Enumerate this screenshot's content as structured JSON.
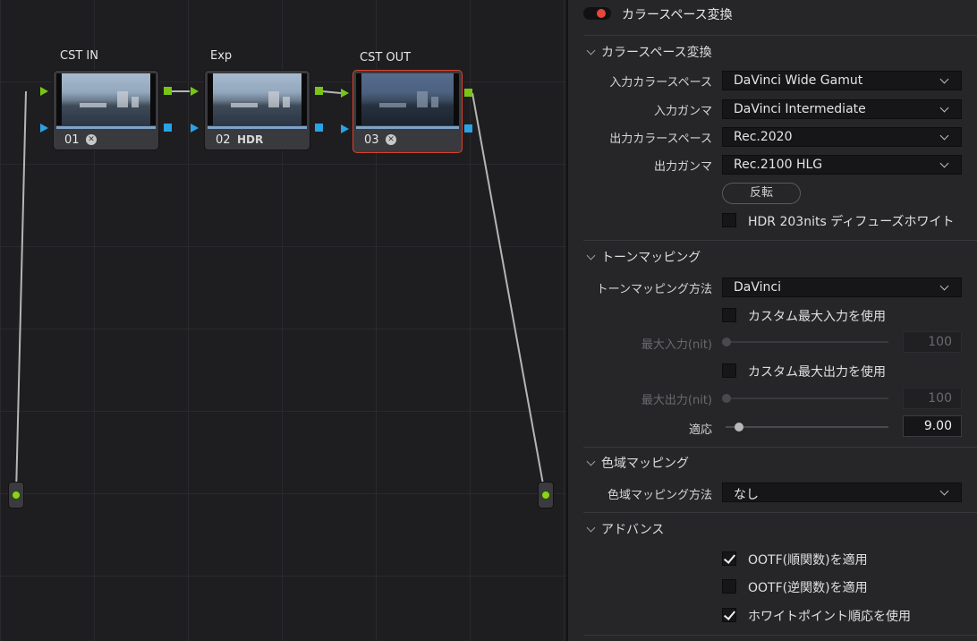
{
  "node_editor": {
    "nodes": [
      {
        "label": "CST IN",
        "num": "01",
        "icon": "color-space-transform-icon"
      },
      {
        "label": "Exp",
        "num": "02",
        "icon": "hdr-icon",
        "icon_text": "HDR"
      },
      {
        "label": "CST OUT",
        "num": "03",
        "icon": "color-space-transform-icon",
        "selected": true
      }
    ]
  },
  "inspector": {
    "title": "カラースペース変換",
    "sections": {
      "cst": {
        "heading": "カラースペース変換",
        "input_colorspace_label": "入力カラースペース",
        "input_colorspace_value": "DaVinci Wide Gamut",
        "input_gamma_label": "入力ガンマ",
        "input_gamma_value": "DaVinci Intermediate",
        "output_colorspace_label": "出力カラースペース",
        "output_colorspace_value": "Rec.2020",
        "output_gamma_label": "出力ガンマ",
        "output_gamma_value": "Rec.2100 HLG",
        "invert_button": "反転",
        "hdr_white_label": "HDR 203nits ディフューズホワイト",
        "hdr_white_checked": false
      },
      "tone": {
        "heading": "トーンマッピング",
        "method_label": "トーンマッピング方法",
        "method_value": "DaVinci",
        "custom_max_input_label": "カスタム最大入力を使用",
        "max_input_label": "最大入力(nit)",
        "max_input_value": "100",
        "custom_max_output_label": "カスタム最大出力を使用",
        "max_output_label": "最大出力(nit)",
        "max_output_value": "100",
        "adapt_label": "適応",
        "adapt_value": "9.00"
      },
      "gamut": {
        "heading": "色域マッピング",
        "method_label": "色域マッピング方法",
        "method_value": "なし"
      },
      "advanced": {
        "heading": "アドバンス",
        "ootf_forward_label": "OOTF(順関数)を適用",
        "ootf_forward_checked": true,
        "ootf_inverse_label": "OOTF(逆関数)を適用",
        "ootf_inverse_checked": false,
        "white_point_label": "ホワイトポイント順応を使用",
        "white_point_checked": true
      }
    }
  },
  "colors": {
    "accent_red": "#e8463a",
    "port_green": "#7ac417",
    "port_blue": "#2aa3e6",
    "selected_border": "#d8402e"
  }
}
